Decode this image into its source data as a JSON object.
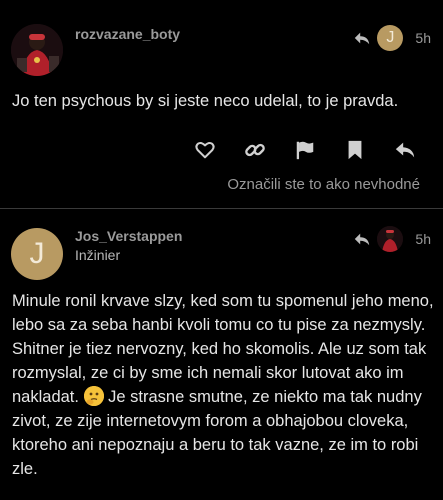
{
  "post1": {
    "username": "rozvazane_boty",
    "time": "5h",
    "body": "Jo ten psychous by si jeste neco udelal, to je pravda.",
    "flag_note": "Označili ste to ako nevhodné"
  },
  "post2": {
    "username": "Jos_Verstappen",
    "user_title": "Inžinier",
    "avatar_letter": "J",
    "time": "5h",
    "body_before_emoji": "Minule ronil krvave slzy, ked som tu spomenul jeho meno, lebo sa za seba hanbi kvoli tomu co tu pise za nezmysly. Shitner je tiez nervozny, ked ho skomolis. Ale uz som tak rozmyslal, ze ci by sme ich nemali skor lutovat ako im nakladat.",
    "body_after_emoji": " Je strasne smutne, ze niekto ma tak nudny zivot, ze zije internetovym forom a obhajobou cloveka, ktoreho ani nepoznaju a beru to tak vazne, ze im to robi zle."
  },
  "reply_to_avatar_letter": "J",
  "icons": [
    "reply-arrow-icon",
    "heart-icon",
    "link-icon",
    "flag-icon",
    "bookmark-icon",
    "reply-icon",
    "thinking-emoji-icon"
  ],
  "colors": {
    "background": "#000000",
    "muted": "#9a9a9a",
    "avatar_tan": "#b89a62"
  }
}
